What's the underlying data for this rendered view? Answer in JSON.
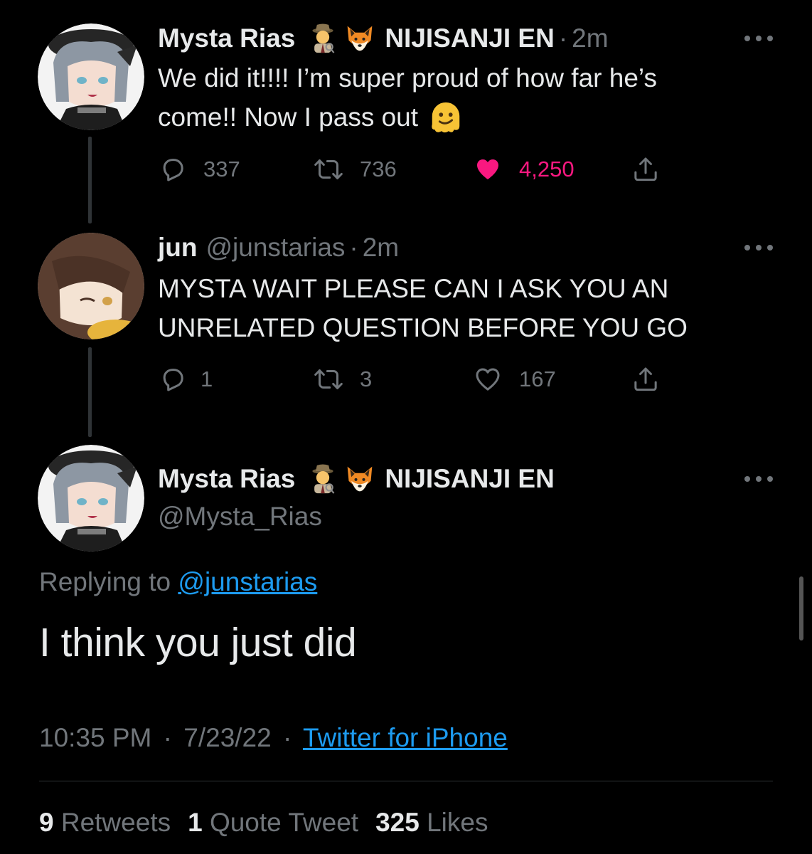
{
  "tweet1": {
    "name": "Mysta Rias",
    "org": "NIJISANJI EN",
    "time": "2m",
    "text_line1": "We did it!!!! I’m super proud of how far he’s",
    "text_line2": "come!! Now I pass out",
    "emoji_after_text": "melting-face",
    "replies": "337",
    "retweets": "736",
    "likes": "4,250",
    "liked": true
  },
  "tweet2": {
    "name": "jun",
    "handle": "@junstarias",
    "time": "2m",
    "text_line1": "MYSTA WAIT PLEASE CAN I ASK YOU AN",
    "text_line2": "UNRELATED QUESTION BEFORE YOU GO",
    "replies": "1",
    "retweets": "3",
    "likes": "167",
    "liked": false
  },
  "main_tweet": {
    "name": "Mysta Rias",
    "org": "NIJISANJI EN",
    "handle": "@Mysta_Rias",
    "replying_label": "Replying to",
    "replying_handle": "@junstarias",
    "text": "I think you just did",
    "time": "10:35 PM",
    "date": "7/23/22",
    "source": "Twitter for iPhone",
    "separator": "·"
  },
  "stats": {
    "retweets_count": "9",
    "retweets_label": "Retweets",
    "quotes_count": "1",
    "quotes_label": "Quote Tweet",
    "likes_count": "325",
    "likes_label": "Likes"
  },
  "icons": {
    "name_emoji_1": "detective-emoji",
    "name_emoji_2": "fox-emoji",
    "reply": "reply-icon",
    "retweet": "retweet-icon",
    "like": "heart-icon",
    "share": "share-icon",
    "more": "more-icon"
  },
  "colors": {
    "background": "#000000",
    "text": "#e7e9ea",
    "muted": "#71767b",
    "link": "#1d9bf0",
    "like": "#f91880"
  }
}
